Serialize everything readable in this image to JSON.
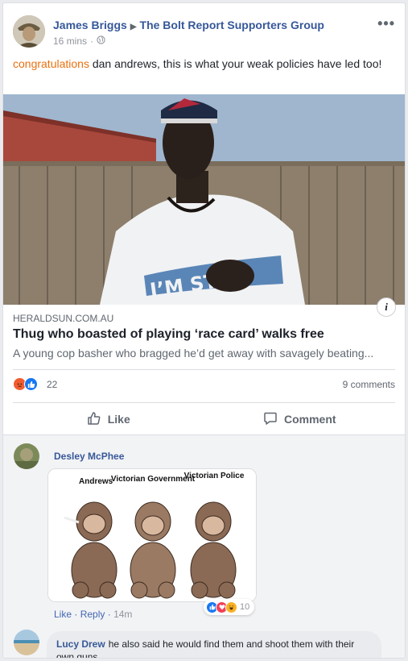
{
  "post": {
    "author": "James Briggs",
    "group": "The Bolt Report Supporters Group",
    "time": "16 mins",
    "privacy_icon": "globe-icon",
    "text_highlight": "congratulations",
    "text_rest": " dan andrews, this is what your weak policies have led too!",
    "more_label": "•••"
  },
  "link": {
    "domain": "HERALDSUN.COM.AU",
    "title": "Thug who boasted of playing ‘race card’ walks free",
    "description": "A young cop basher who bragged he’d get away with savagely beating...",
    "shirt_text": "I’M STILL"
  },
  "reactions": {
    "count": "22",
    "comments": "9 comments",
    "icons": [
      "angry-icon",
      "like-icon"
    ]
  },
  "actions": {
    "like": "Like",
    "comment": "Comment"
  },
  "comments": [
    {
      "author": "Desley McPhee",
      "image_labels": [
        "Andrews",
        "Victorian Government",
        "Victorian Police"
      ],
      "like": "Like",
      "reply": "Reply",
      "time": "14m",
      "reaction_count": "10"
    },
    {
      "author": "Lucy Drew",
      "text": "he also said he would find them and shoot them with their own guns"
    }
  ],
  "colors": {
    "link_blue": "#365899",
    "highlight_orange": "#e9710f",
    "like_blue": "#1877f2",
    "angry_orange": "#f05c30"
  }
}
